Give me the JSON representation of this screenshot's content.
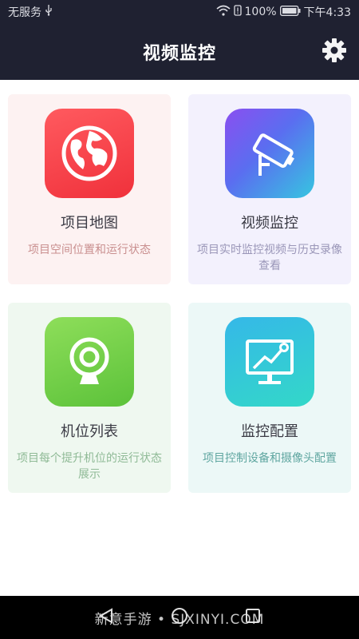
{
  "status_bar": {
    "carrier": "无服务",
    "battery_percent": "100%",
    "time": "下午4:33"
  },
  "header": {
    "title": "视频监控"
  },
  "cards": [
    {
      "title": "项目地图",
      "desc": "项目空间位置和运行状态",
      "icon": "globe-icon"
    },
    {
      "title": "视频监控",
      "desc": "项目实时监控视频与历史录像查看",
      "icon": "camera-icon"
    },
    {
      "title": "机位列表",
      "desc": "项目每个提升机位的运行状态展示",
      "icon": "webcam-icon"
    },
    {
      "title": "监控配置",
      "desc": "项目控制设备和摄像头配置",
      "icon": "monitor-chart-icon"
    }
  ],
  "watermark": "新意手游 • SJXINYI.COM",
  "colors": {
    "bar_background": "#1f2131",
    "card1_bg": "#fdf2f2",
    "card2_bg": "#f3f1fd",
    "card3_bg": "#eff8f0",
    "card4_bg": "#ecf8f7"
  }
}
